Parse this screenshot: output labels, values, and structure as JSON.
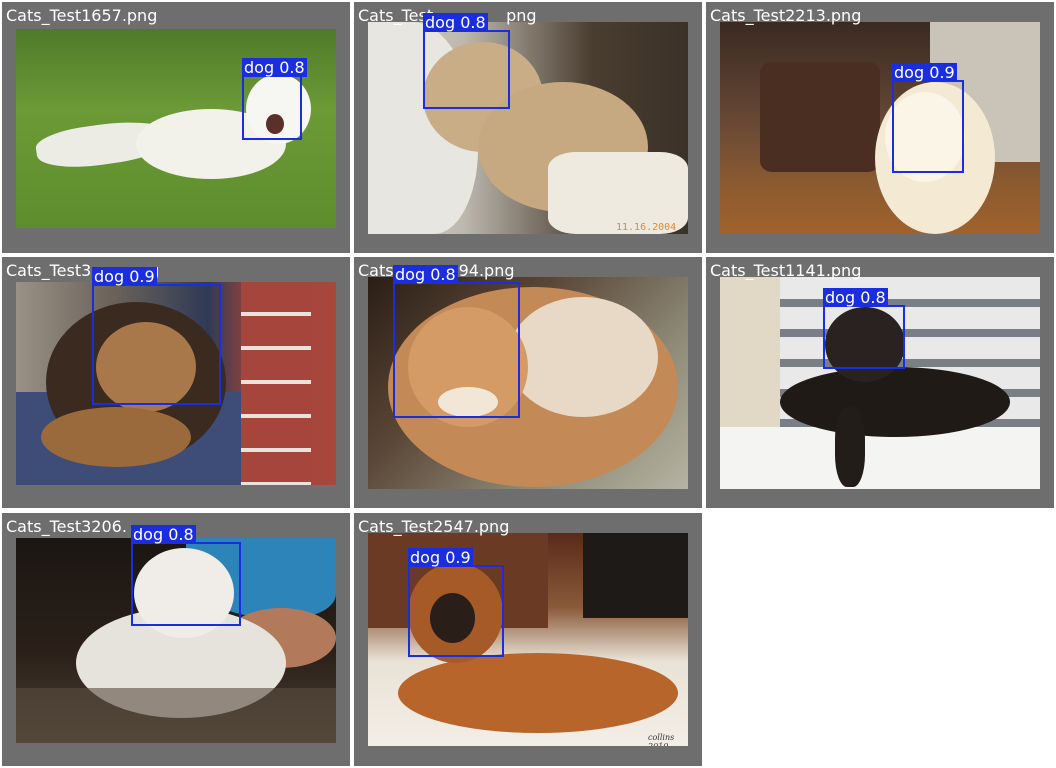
{
  "tiles": [
    {
      "filename": "Cats_Test1657.png",
      "label": "dog 0.8"
    },
    {
      "filename": "Cats_Test",
      "filename_tail": "png",
      "label": "dog 0.8",
      "date_stamp": "11.16.2004"
    },
    {
      "filename": "Cats_Test2213.png",
      "label": "dog 0.9"
    },
    {
      "filename": "Cats_Test3",
      "filename_tail": "g",
      "label": "dog 0.9"
    },
    {
      "filename": "Cats",
      "filename_tail": "94.png",
      "label": "dog 0.8"
    },
    {
      "filename": "Cats_Test1141.png",
      "label": "dog 0.8"
    },
    {
      "filename": "Cats_Test3206.",
      "label": "dog 0.8"
    },
    {
      "filename": "Cats_Test2547.png",
      "label": "dog 0.9",
      "signature": "collins 2010"
    }
  ],
  "colors": {
    "tile_background": "#6e6e6e",
    "box": "#1a2ee0",
    "label_text": "#ffffff"
  }
}
